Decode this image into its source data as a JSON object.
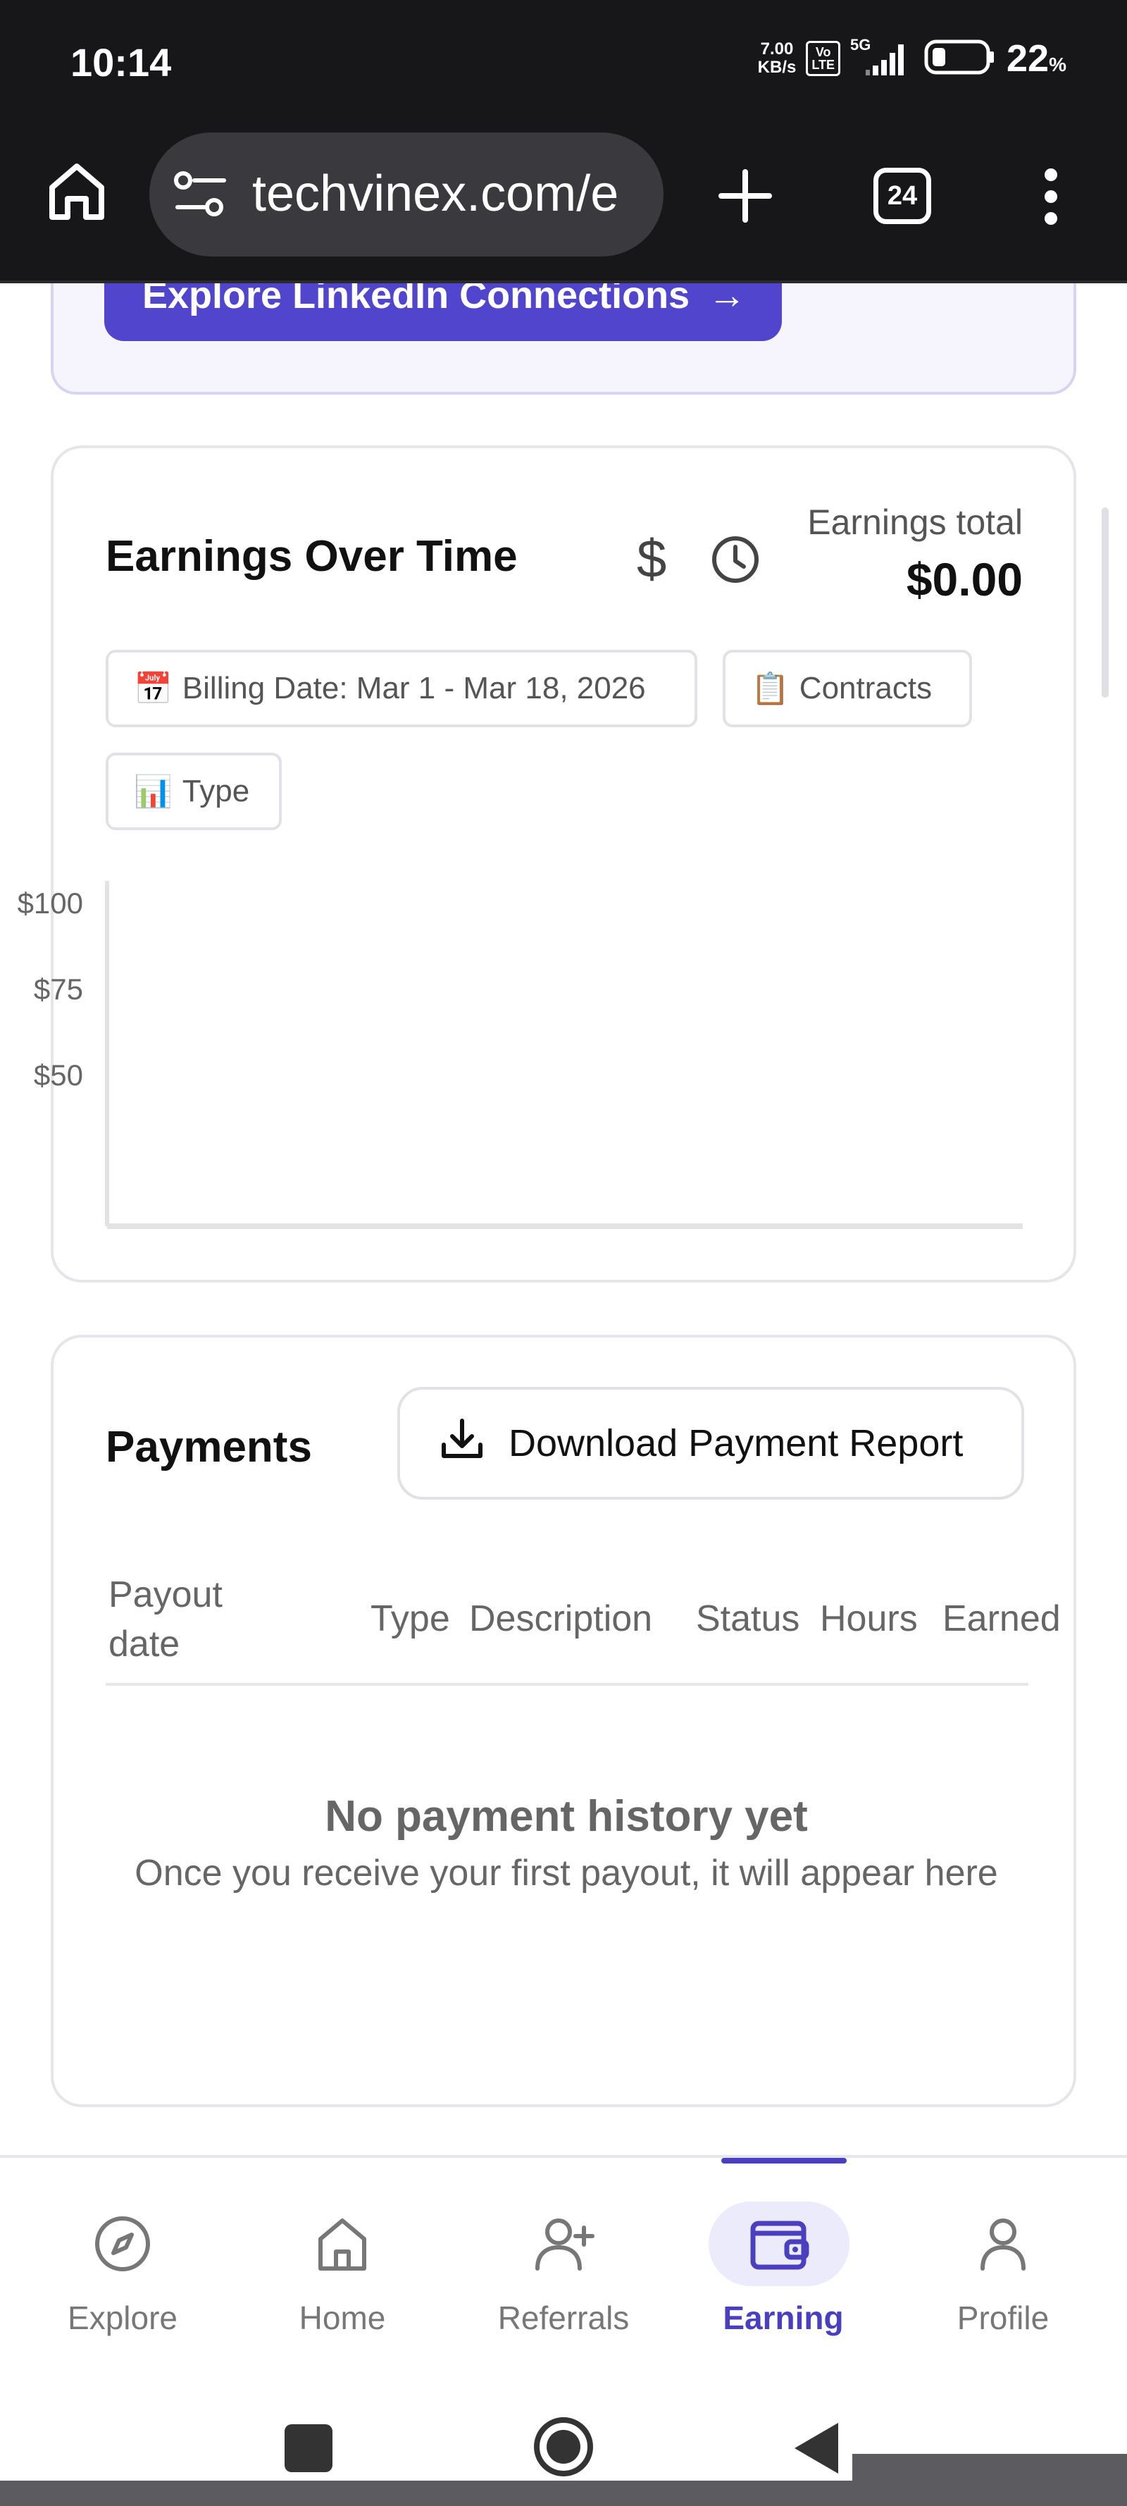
{
  "status_bar": {
    "time": "10:14",
    "net_speed_value": "7.00",
    "net_speed_unit": "KB/s",
    "volte_top": "Vo",
    "volte_bottom": "LTE",
    "network": "5G",
    "battery_percent": "22",
    "battery_unit": "%"
  },
  "browser": {
    "url": "techvinex.com/e",
    "tab_count": "24"
  },
  "top_card": {
    "button_label": "Explore LinkedIn Connections",
    "button_arrow": "→"
  },
  "earnings": {
    "title": "Earnings Over Time",
    "total_label": "Earnings total",
    "total_value": "$0.00",
    "filters": {
      "billing_emoji": "📅",
      "billing_label": "Billing Date: Mar 1 - Mar 18, 2026",
      "contracts_emoji": "📋",
      "contracts_label": "Contracts",
      "type_emoji": "📊",
      "type_label": "Type"
    }
  },
  "chart_data": {
    "type": "line",
    "title": "",
    "xlabel": "",
    "ylabel": "",
    "y_ticks": [
      "$100",
      "$75",
      "$50"
    ],
    "y_tick_values": [
      100,
      75,
      50
    ],
    "ylim": [
      0,
      100
    ],
    "series": [],
    "grid": false
  },
  "payments": {
    "title": "Payments",
    "download_label": "Download Payment Report",
    "columns": {
      "payout_date": "Payout date",
      "type": "Type",
      "description": "Description",
      "status": "Status",
      "hours": "Hours",
      "earned": "Earned"
    },
    "empty_title": "No payment history yet",
    "empty_subtitle": "Once you receive your first payout, it will appear here"
  },
  "bottom_nav": {
    "items": [
      {
        "label": "Explore",
        "icon": "compass-icon"
      },
      {
        "label": "Home",
        "icon": "home-icon"
      },
      {
        "label": "Referrals",
        "icon": "add-user-icon"
      },
      {
        "label": "Earning",
        "icon": "wallet-icon",
        "active": true
      },
      {
        "label": "Profile",
        "icon": "user-icon"
      }
    ]
  },
  "colors": {
    "accent": "#5145cd",
    "active_nav": "#4a3fbf",
    "status_bar_bg": "#17171a"
  }
}
